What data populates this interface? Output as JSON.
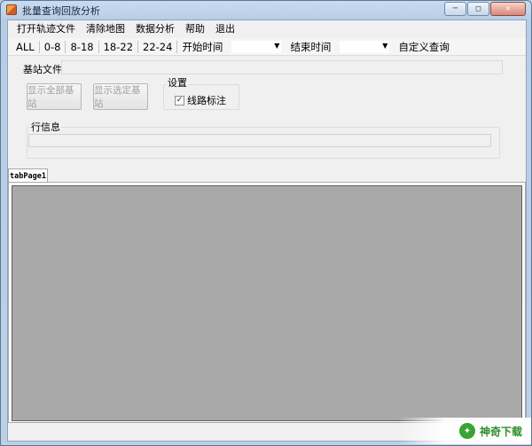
{
  "window": {
    "title": "批量查询回放分析",
    "min_glyph": "─",
    "max_glyph": "□",
    "close_glyph": "✕"
  },
  "menu": [
    "打开轨迹文件",
    "清除地图",
    "数据分析",
    "帮助",
    "退出"
  ],
  "toolbar": {
    "filters": [
      "ALL",
      "0-8",
      "8-18",
      "18-22",
      "22-24"
    ],
    "start_label": "开始时间",
    "start_value": "",
    "end_label": "结束时间",
    "end_value": "",
    "custom_query": "自定义查询"
  },
  "station": {
    "label": "基站文件",
    "value": ""
  },
  "buttons": {
    "show_all": "显示全部基站",
    "show_selected": "显示选定基站"
  },
  "settings": {
    "title": "设置",
    "route_label": "线路标注",
    "route_checked": true
  },
  "row_info": {
    "title": "行信息",
    "value": ""
  },
  "tabs": [
    "tabPage1"
  ],
  "watermark": {
    "text": "神奇下载"
  },
  "icons": [
    "app-icon",
    "minimize-icon",
    "maximize-icon",
    "close-icon",
    "dropdown-arrow-icon",
    "checkmark-icon"
  ]
}
